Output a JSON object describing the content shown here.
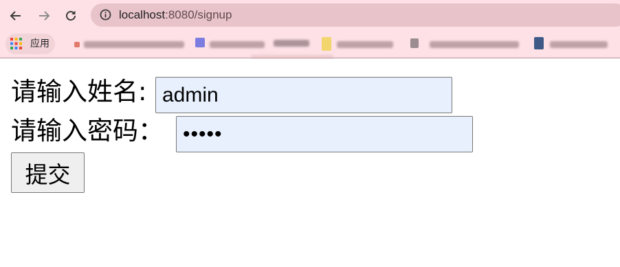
{
  "browser": {
    "url_host": "localhost",
    "url_rest": ":8080/signup",
    "bookmarks_label": "应用"
  },
  "form": {
    "name_label": "请输入姓名:",
    "name_value": "admin",
    "password_label": "请输入密码：",
    "password_value": "•••••",
    "submit_label": "提交"
  },
  "colors": {
    "toolbar_bg": "#fde1e6",
    "omnibox_bg": "#e8c3c9",
    "input_bg": "#e8f0fe"
  }
}
